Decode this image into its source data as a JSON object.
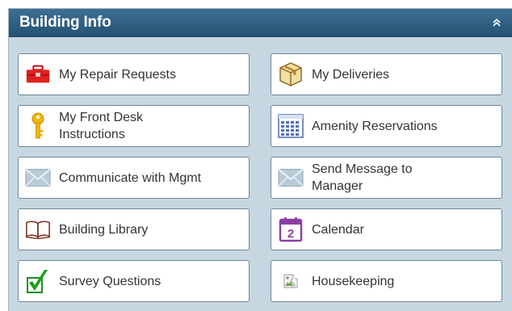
{
  "panel": {
    "title": "Building Info"
  },
  "tiles": [
    {
      "label": "My Repair Requests",
      "icon": "toolbox-icon"
    },
    {
      "label": "My Deliveries",
      "icon": "package-icon"
    },
    {
      "label": "My Front Desk\nInstructions",
      "icon": "key-icon"
    },
    {
      "label": "Amenity Reservations",
      "icon": "calendar-grid-icon"
    },
    {
      "label": "Communicate with Mgmt",
      "icon": "envelope-icon"
    },
    {
      "label": "Send Message to\nManager",
      "icon": "envelope-icon"
    },
    {
      "label": "Building Library",
      "icon": "book-icon"
    },
    {
      "label": "Calendar",
      "icon": "calendar-icon",
      "day": "2"
    },
    {
      "label": "Survey Questions",
      "icon": "checkmark-icon"
    },
    {
      "label": "Housekeeping",
      "icon": "broken-image-icon"
    }
  ],
  "colors": {
    "header": "#2e5f82",
    "panel_bg": "#c7d7e2",
    "tile_border": "#6f8796",
    "toolbox": "#e0201c",
    "key": "#f2b600",
    "package": "#b8862a",
    "calendar": "#8b3fa3",
    "check": "#1aa01a"
  }
}
